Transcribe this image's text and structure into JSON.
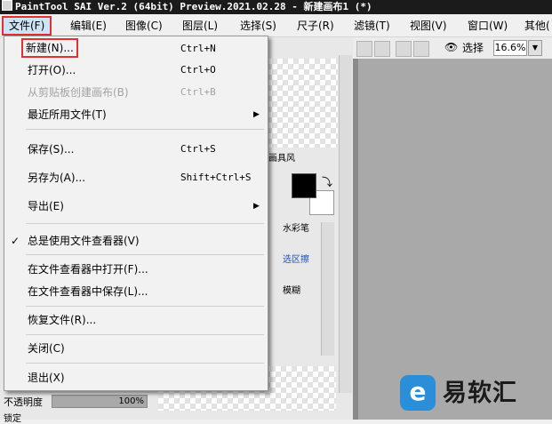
{
  "window": {
    "title": "PaintTool SAI Ver.2 (64bit) Preview.2021.02.28 - 新建画布1 (*)"
  },
  "menubar": {
    "items": [
      {
        "label": "文件(F)",
        "active": true
      },
      {
        "label": "编辑(E)"
      },
      {
        "label": "图像(C)"
      },
      {
        "label": "图层(L)"
      },
      {
        "label": "选择(S)"
      },
      {
        "label": "尺子(R)"
      },
      {
        "label": "滤镜(T)"
      },
      {
        "label": "视图(V)"
      },
      {
        "label": "窗口(W)"
      },
      {
        "label": "其他("
      }
    ]
  },
  "file_menu": {
    "items": [
      {
        "label": "新建(N)...",
        "shortcut": "Ctrl+N",
        "highlight": true
      },
      {
        "label": "打开(O)...",
        "shortcut": "Ctrl+O"
      },
      {
        "label": "从剪贴板创建画布(B)",
        "shortcut": "Ctrl+B",
        "disabled": true
      },
      {
        "label": "最近所用文件(T)",
        "submenu": true
      },
      {
        "label": "保存(S)...",
        "shortcut": "Ctrl+S"
      },
      {
        "label": "另存为(A)...",
        "shortcut": "Shift+Ctrl+S"
      },
      {
        "label": "导出(E)",
        "submenu": true
      },
      {
        "label": "总是使用文件查看器(V)",
        "checked": true
      },
      {
        "label": "在文件查看器中打开(F)..."
      },
      {
        "label": "在文件查看器中保存(L)..."
      },
      {
        "label": "恢复文件(R)..."
      },
      {
        "label": "关闭(C)"
      },
      {
        "label": "退出(X)"
      }
    ],
    "submenu_arrow": "▶",
    "check_mark": "✓"
  },
  "canvas_toolbar": {
    "select_label": "选择",
    "zoom_value": "16.6%",
    "zoom_arrow": "▼",
    "eye_icon": "👁"
  },
  "tool_panel": {
    "tab_partial": "画具风",
    "tools": {
      "watercolor": "水彩笔",
      "select_region": "选区擦",
      "blur": "模糊"
    },
    "swap_icon": "⤵"
  },
  "layer_panel": {
    "opacity_label": "不透明度",
    "opacity_value": "100%",
    "opacity_fraction": 1.0,
    "lock_label": "锁定"
  },
  "watermark": {
    "logo_glyph": "e",
    "text": "易软汇",
    "logo_color": "#2b8ed9"
  }
}
